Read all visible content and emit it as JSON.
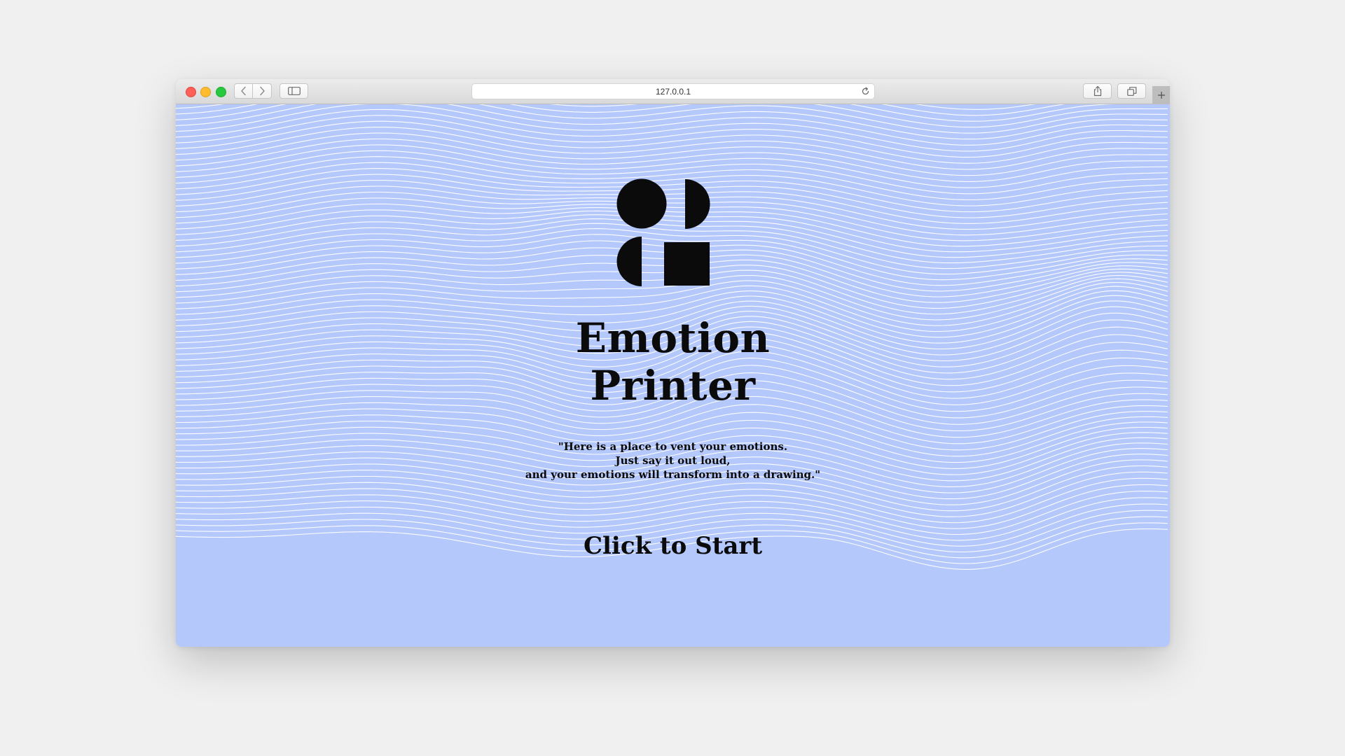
{
  "browser": {
    "url": "127.0.0.1"
  },
  "page": {
    "title_line1": "Emotion",
    "title_line2": "Printer",
    "tagline_line1": "\"Here is a place to vent your emotions.",
    "tagline_line2": "Just say it out loud,",
    "tagline_line3": "and your emotions will transform into a drawing.\"",
    "start_label": "Click to Start"
  },
  "colors": {
    "background": "#b5c8fb",
    "wave_lines": "#ffffff",
    "text": "#0b0b0b"
  },
  "icons": {
    "logo": "shapes-logo-icon",
    "back": "chevron-left-icon",
    "forward": "chevron-right-icon",
    "sidebar": "sidebar-icon",
    "reload": "reload-icon",
    "share": "share-icon",
    "tabs": "tabs-overview-icon",
    "new_tab": "plus-icon"
  }
}
